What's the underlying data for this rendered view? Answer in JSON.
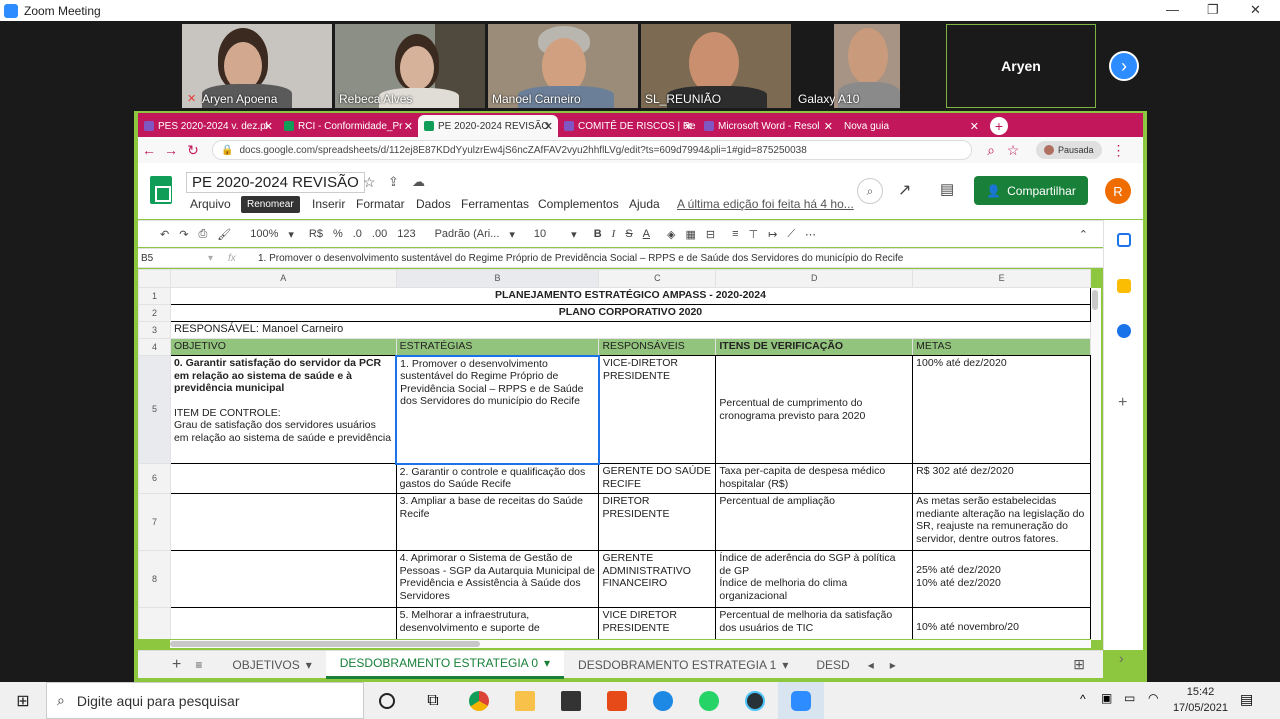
{
  "zoom": {
    "title": "Zoom Meeting",
    "win_controls": [
      "—",
      "❐",
      "✕"
    ]
  },
  "participants": [
    {
      "name": "Aryen Apoena"
    },
    {
      "name": "Rebeca Alves"
    },
    {
      "name": "Manoel Carneiro"
    },
    {
      "name": "SL_REUNIÃO"
    },
    {
      "name": "Galaxy A10"
    },
    {
      "name": "Aryen"
    }
  ],
  "browser": {
    "tabs": [
      {
        "label": "PES 2020-2024 v. dez.pl",
        "active": false
      },
      {
        "label": "RCI - Conformidade_Pr",
        "active": false
      },
      {
        "label": "PE 2020-2024 REVISÃO",
        "active": true
      },
      {
        "label": "COMITÊ DE RISCOS | Re",
        "active": false
      },
      {
        "label": "Microsoft Word - Resol",
        "active": false
      },
      {
        "label": "Nova guia",
        "active": false
      }
    ],
    "url": "docs.google.com/spreadsheets/d/112ej8E87KDdYyulzrEw4jS6ncZAfFAV2vyu2hhflLVg/edit?ts=609d7994&pli=1#gid=875250038",
    "profile_label": "Pausada"
  },
  "sheets": {
    "doc_title": "PE 2020-2024 REVISÃO",
    "menu": [
      "Arquivo",
      "Editar",
      "Ver",
      "Inserir",
      "Formatar",
      "Dados",
      "Ferramentas",
      "Complementos",
      "Ajuda"
    ],
    "tooltip": "Renomear",
    "last_edit": "A última edição foi feita há 4 ho...",
    "share_label": "Compartilhar",
    "avatar_letter": "R",
    "toolbar": {
      "zoom": "100%",
      "currency": "R$",
      "percent": "%",
      "dec_less": ".0",
      "dec_more": ".00",
      "format": "123",
      "font": "Padrão (Ari...",
      "size": "10"
    },
    "cell_ref": "B5",
    "fx": "fx",
    "formula": "1. Promover o desenvolvimento sustentável do Regime Próprio de Previdência Social – RPPS e de Saúde dos Servidores do município do Recife",
    "columns": [
      "A",
      "B",
      "C",
      "D",
      "E"
    ],
    "rows": {
      "r1": "PLANEJAMENTO ESTRATÉGICO AMPASS - 2020-2024",
      "r2": "PLANO CORPORATIVO 2020",
      "r3": "RESPONSÁVEL: Manoel Carneiro",
      "r4": [
        "OBJETIVO",
        "ESTRATÉGIAS",
        "RESPONSÁVEIS",
        "ITENS DE VERIFICAÇÃO",
        "METAS"
      ],
      "r5": {
        "a_bold": "0. Garantir satisfação do servidor da PCR em relação ao sistema de saúde e à previdência municipal",
        "a_item": "ITEM DE CONTROLE:",
        "a_text": "Grau de satisfação dos servidores usuários em relação ao sistema de saúde e previdência",
        "b": "1. Promover o desenvolvimento sustentável do Regime Próprio de Previdência Social – RPPS e de Saúde dos Servidores do município do Recife",
        "c": "VICE-DIRETOR PRESIDENTE",
        "d": "Percentual de cumprimento do cronograma previsto para 2020",
        "e": "100% até dez/2020"
      },
      "r6": {
        "b": "2. Garantir o controle e qualificação dos gastos do Saúde Recife",
        "c": "GERENTE DO SAÚDE RECIFE",
        "d": "Taxa per-capita de despesa médico hospitalar (R$)",
        "e": "R$ 302 até dez/2020"
      },
      "r7": {
        "b": "3. Ampliar a base de receitas do Saúde Recife",
        "c": "DIRETOR PRESIDENTE",
        "d": "Percentual de ampliação",
        "e": "As metas serão estabelecidas mediante alteração na legislação do SR, reajuste na remuneração do servidor, dentre outros fatores."
      },
      "r8": {
        "b": "4. Aprimorar o Sistema de Gestão de Pessoas - SGP da Autarquia Municipal de Previdência e Assistência à Saúde dos Servidores",
        "c": "GERENTE ADMINISTRATIVO FINANCEIRO",
        "d1": "Índice de aderência do SGP à política de GP",
        "d2": "Índice de melhoria do clima organizacional",
        "e1": "25% até dez/2020",
        "e2": "10% até dez/2020"
      },
      "r9": {
        "b": "5. Melhorar a infraestrutura, desenvolvimento e suporte de",
        "c": "VICE DIRETOR PRESIDENTE",
        "d": "Percentual de melhoria da satisfação dos usuários de TIC",
        "e": "10% até novembro/20"
      }
    },
    "sheet_tabs": [
      "OBJETIVOS",
      "DESDOBRAMENTO ESTRATEGIA 0",
      "DESDOBRAMENTO ESTRATEGIA 1",
      "DESD"
    ]
  },
  "taskbar": {
    "search_placeholder": "Digite aqui para pesquisar",
    "time": "15:42",
    "date": "17/05/2021"
  }
}
